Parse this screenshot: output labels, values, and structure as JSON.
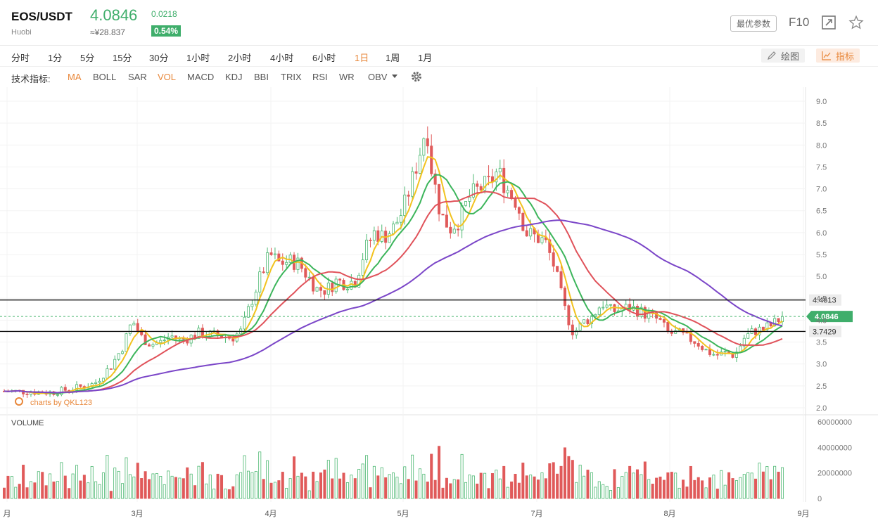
{
  "header": {
    "symbol": "EOS/USDT",
    "exchange": "Huobi",
    "price": "4.0846",
    "cny_price": "≈¥28.837",
    "change": "0.0218",
    "change_pct": "0.54%",
    "best_params_label": "最优参数",
    "f10_label": "F10"
  },
  "toolbar": {
    "timeframes": [
      "分时",
      "1分",
      "5分",
      "15分",
      "30分",
      "1小时",
      "2小时",
      "4小时",
      "6小时",
      "1日",
      "1周",
      "1月"
    ],
    "active_timeframe": "1日",
    "draw_label": "绘图",
    "indicator_label": "指标"
  },
  "indicators": {
    "title": "技术指标:",
    "items": [
      "MA",
      "BOLL",
      "SAR",
      "VOL",
      "MACD",
      "KDJ",
      "BBI",
      "TRIX",
      "RSI",
      "WR",
      "OBV"
    ],
    "active": [
      "MA",
      "VOL"
    ]
  },
  "chart_data": {
    "type": "candlestick",
    "watermark": "charts by QKL123",
    "price_axis_ticks": [
      9.0,
      8.5,
      8.0,
      7.5,
      7.0,
      6.5,
      6.0,
      5.5,
      5.0,
      4.5,
      4.0,
      3.5,
      3.0,
      2.5,
      2.0
    ],
    "ylim": [
      1.9,
      9.2
    ],
    "horizontal_levels": [
      {
        "label": "4.4613",
        "value": 4.4613
      },
      {
        "label": "3.7429",
        "value": 3.7429
      }
    ],
    "last_price_label": "4.0846",
    "last_price": 4.0846,
    "x_tick_labels": [
      "月",
      "3月",
      "4月",
      "5月",
      "7月",
      "8月",
      "9月"
    ],
    "candle_count": 205,
    "price_path": [
      [
        0,
        2.38
      ],
      [
        20,
        2.35
      ],
      [
        30,
        2.45
      ],
      [
        38,
        2.55
      ],
      [
        45,
        2.95
      ],
      [
        50,
        3.4
      ],
      [
        54,
        4.0
      ],
      [
        58,
        3.6
      ],
      [
        62,
        3.45
      ],
      [
        66,
        3.5
      ],
      [
        70,
        3.65
      ],
      [
        74,
        3.55
      ],
      [
        78,
        3.6
      ],
      [
        82,
        3.7
      ],
      [
        90,
        3.65
      ],
      [
        96,
        3.6
      ],
      [
        100,
        3.75
      ],
      [
        104,
        4.4
      ],
      [
        108,
        5.0
      ],
      [
        112,
        5.5
      ],
      [
        116,
        5.3
      ],
      [
        120,
        5.35
      ],
      [
        124,
        5.3
      ],
      [
        128,
        5.0
      ],
      [
        132,
        4.7
      ],
      [
        136,
        4.7
      ],
      [
        140,
        4.9
      ],
      [
        144,
        4.85
      ],
      [
        148,
        4.9
      ],
      [
        152,
        5.6
      ],
      [
        156,
        6.0
      ],
      [
        160,
        5.9
      ],
      [
        164,
        6.1
      ],
      [
        168,
        6.5
      ],
      [
        172,
        7.2
      ],
      [
        176,
        8.0
      ],
      [
        178,
        8.5
      ],
      [
        180,
        7.5
      ],
      [
        184,
        6.4
      ],
      [
        188,
        6.1
      ],
      [
        192,
        6.3
      ],
      [
        196,
        6.8
      ],
      [
        200,
        7.0
      ],
      [
        204,
        7.1
      ],
      [
        208,
        7.4
      ],
      [
        212,
        7.0
      ],
      [
        216,
        6.7
      ],
      [
        220,
        6.0
      ],
      [
        224,
        5.9
      ],
      [
        228,
        5.8
      ],
      [
        232,
        5.2
      ],
      [
        236,
        4.3
      ],
      [
        240,
        3.7
      ],
      [
        244,
        3.95
      ],
      [
        248,
        4.1
      ],
      [
        252,
        4.4
      ],
      [
        256,
        4.2
      ],
      [
        260,
        4.25
      ],
      [
        264,
        4.3
      ],
      [
        268,
        4.2
      ],
      [
        272,
        4.1
      ],
      [
        276,
        4.0
      ],
      [
        280,
        3.7
      ],
      [
        284,
        3.7
      ],
      [
        288,
        3.6
      ],
      [
        292,
        3.5
      ],
      [
        296,
        3.3
      ],
      [
        300,
        3.2
      ],
      [
        304,
        3.25
      ],
      [
        308,
        3.2
      ],
      [
        312,
        3.6
      ],
      [
        316,
        3.75
      ],
      [
        320,
        3.8
      ],
      [
        324,
        3.9
      ],
      [
        328,
        4.08
      ]
    ],
    "ma_lines": [
      {
        "name": "MA5",
        "color": "#f2c21f"
      },
      {
        "name": "MA10",
        "color": "#3cb55b"
      },
      {
        "name": "MA20",
        "color": "#e0525a"
      },
      {
        "name": "MA60",
        "color": "#7b46c8"
      }
    ],
    "volume_axis_ticks": [
      "60000000",
      "40000000",
      "20000000",
      "0"
    ],
    "volume_label": "VOLUME",
    "volume_max": 60000000
  }
}
